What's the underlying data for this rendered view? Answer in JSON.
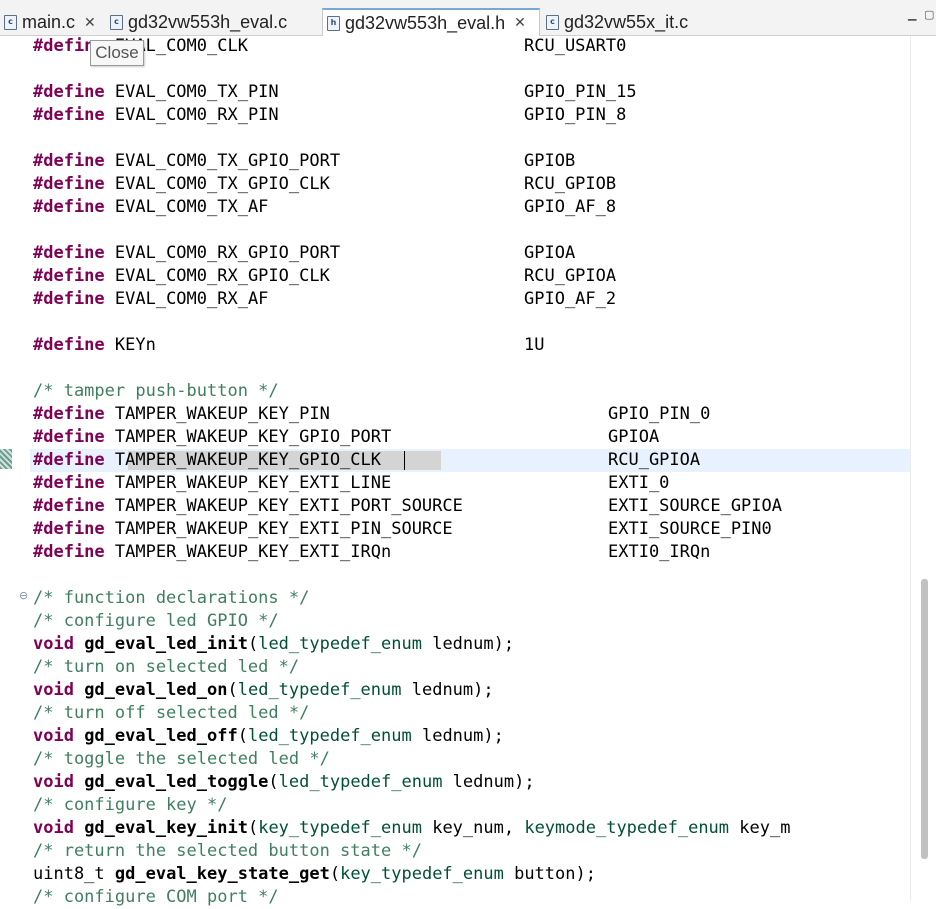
{
  "tabs": [
    {
      "label": "main.c",
      "icon": "c-file-icon",
      "active": false
    },
    {
      "label": "gd32vw553h_eval.c",
      "icon": "c-file-icon",
      "active": false
    },
    {
      "label": "gd32vw553h_eval.h",
      "icon": "h-file-icon",
      "active": true
    },
    {
      "label": "gd32vw55x_it.c",
      "icon": "c-file-icon",
      "active": false
    }
  ],
  "tab_close_glyph": "✕",
  "tooltip": "Close",
  "icon_letters": {
    "c": "c",
    "h": "h"
  },
  "code": {
    "l1": {
      "kw": "#define",
      "name": " EVAL_COM0_CLK",
      "val": "RCU_USART0"
    },
    "l2": {
      "kw": "#define",
      "name": " EVAL_COM0_TX_PIN",
      "val": "GPIO_PIN_15"
    },
    "l3": {
      "kw": "#define",
      "name": " EVAL_COM0_RX_PIN",
      "val": "GPIO_PIN_8"
    },
    "l4": {
      "kw": "#define",
      "name": " EVAL_COM0_TX_GPIO_PORT",
      "val": "GPIOB"
    },
    "l5": {
      "kw": "#define",
      "name": " EVAL_COM0_TX_GPIO_CLK",
      "val": "RCU_GPIOB"
    },
    "l6": {
      "kw": "#define",
      "name": " EVAL_COM0_TX_AF",
      "val": "GPIO_AF_8"
    },
    "l7": {
      "kw": "#define",
      "name": " EVAL_COM0_RX_GPIO_PORT",
      "val": "GPIOA"
    },
    "l8": {
      "kw": "#define",
      "name": " EVAL_COM0_RX_GPIO_CLK",
      "val": "RCU_GPIOA"
    },
    "l9": {
      "kw": "#define",
      "name": " EVAL_COM0_RX_AF",
      "val": "GPIO_AF_2"
    },
    "l10": {
      "kw": "#define",
      "name": " KEYn",
      "val": "1U"
    },
    "c1": "/* tamper push-button */",
    "t1": {
      "kw": "#define",
      "name": " TAMPER_WAKEUP_KEY_PIN",
      "val": "GPIO_PIN_0"
    },
    "t2": {
      "kw": "#define",
      "name": " TAMPER_WAKEUP_KEY_GPIO_PORT",
      "val": "GPIOA"
    },
    "t3": {
      "kw": "#define",
      "name": " TAMPER_WAKEUP_KEY_GPIO_CLK",
      "val": "RCU_GPIOA"
    },
    "t4": {
      "kw": "#define",
      "name": " TAMPER_WAKEUP_KEY_EXTI_LINE",
      "val": "EXTI_0"
    },
    "t5": {
      "kw": "#define",
      "name": " TAMPER_WAKEUP_KEY_EXTI_PORT_SOURCE",
      "val": "EXTI_SOURCE_GPIOA"
    },
    "t6": {
      "kw": "#define",
      "name": " TAMPER_WAKEUP_KEY_EXTI_PIN_SOURCE",
      "val": "EXTI_SOURCE_PIN0"
    },
    "t7": {
      "kw": "#define",
      "name": " TAMPER_WAKEUP_KEY_EXTI_IRQn",
      "val": "EXTI0_IRQn"
    },
    "c2": "/* function declarations */",
    "c3": "/* configure led GPIO */",
    "f1": {
      "ret": "void",
      "fn": " gd_eval_led_init",
      "open": "(",
      "ty": "led_typedef_enum",
      "rest": " lednum);"
    },
    "c4": "/* turn on selected led */",
    "f2": {
      "ret": "void",
      "fn": " gd_eval_led_on",
      "open": "(",
      "ty": "led_typedef_enum",
      "rest": " lednum);"
    },
    "c5": "/* turn off selected led */",
    "f3": {
      "ret": "void",
      "fn": " gd_eval_led_off",
      "open": "(",
      "ty": "led_typedef_enum",
      "rest": " lednum);"
    },
    "c6": "/* toggle the selected led */",
    "f4": {
      "ret": "void",
      "fn": " gd_eval_led_toggle",
      "open": "(",
      "ty": "led_typedef_enum",
      "rest": " lednum);"
    },
    "c7": "/* configure key */",
    "f5": {
      "ret": "void",
      "fn": " gd_eval_key_init",
      "open": "(",
      "ty": "key_typedef_enum",
      "mid": " key_num, ",
      "ty2": "keymode_typedef_enum",
      "rest": " key_m"
    },
    "c8": "/* return the selected button state */",
    "f6": {
      "ret": "uint8_t",
      "fn": " gd_eval_key_state_get",
      "open": "(",
      "ty": "key_typedef_enum",
      "rest": " button);"
    },
    "c9": "/* configure COM port */"
  },
  "colors": {
    "keyword": "#7f0055",
    "comment": "#3f7f5f",
    "type": "#005032",
    "current_line": "#e8f2fe"
  }
}
